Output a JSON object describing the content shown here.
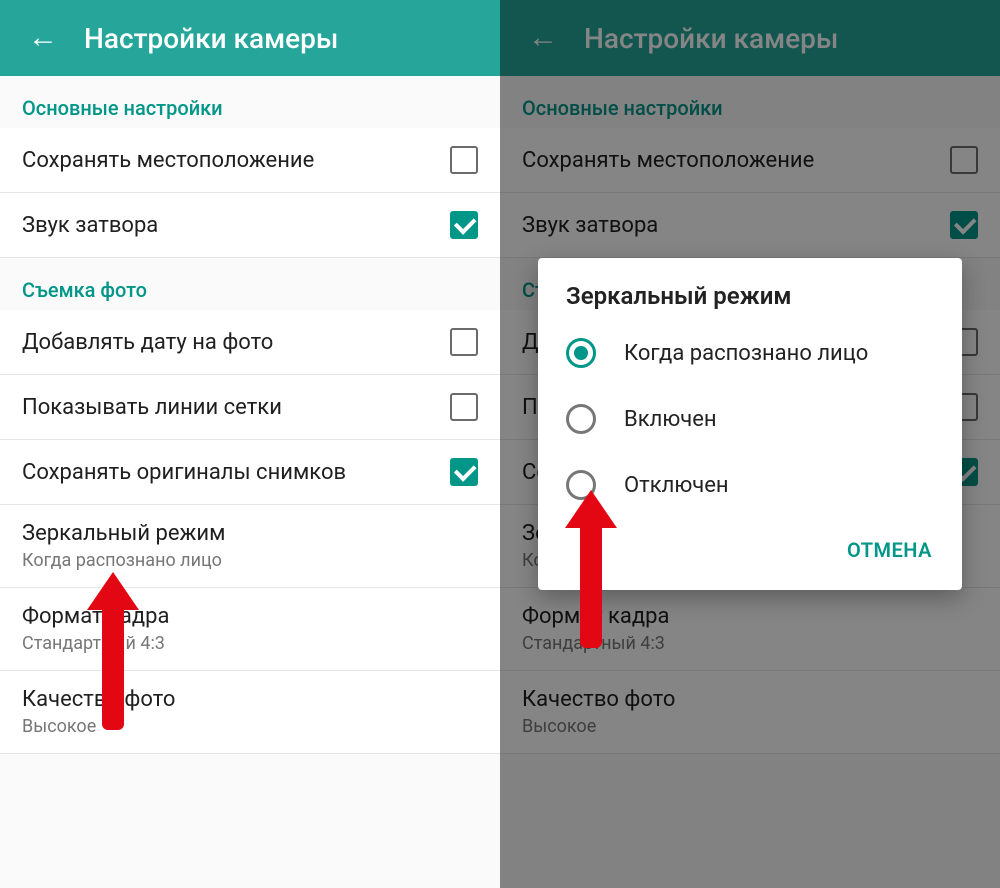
{
  "left": {
    "appbar": {
      "title": "Настройки камеры"
    },
    "sections": {
      "general": {
        "header": "Основные настройки",
        "save_location": {
          "label": "Сохранять местоположение",
          "checked": false
        },
        "shutter_sound": {
          "label": "Звук затвора",
          "checked": true
        }
      },
      "photo": {
        "header": "Съемка фото",
        "add_date": {
          "label": "Добавлять дату на фото",
          "checked": false
        },
        "grid_lines": {
          "label": "Показывать линии сетки",
          "checked": false
        },
        "save_originals": {
          "label": "Сохранять оригиналы снимков",
          "checked": true
        },
        "mirror_mode": {
          "label": "Зеркальный режим",
          "sub": "Когда распознано лицо"
        },
        "frame_format": {
          "label": "Формат кадра",
          "sub": "Стандартный 4:3"
        },
        "photo_quality": {
          "label": "Качество фото",
          "sub": "Высокое"
        }
      }
    }
  },
  "right": {
    "appbar": {
      "title": "Настройки камеры"
    },
    "dialog": {
      "title": "Зеркальный режим",
      "options": [
        {
          "label": "Когда распознано лицо",
          "selected": true
        },
        {
          "label": "Включен",
          "selected": false
        },
        {
          "label": "Отключен",
          "selected": false
        }
      ],
      "cancel": "ОТМЕНА"
    }
  }
}
